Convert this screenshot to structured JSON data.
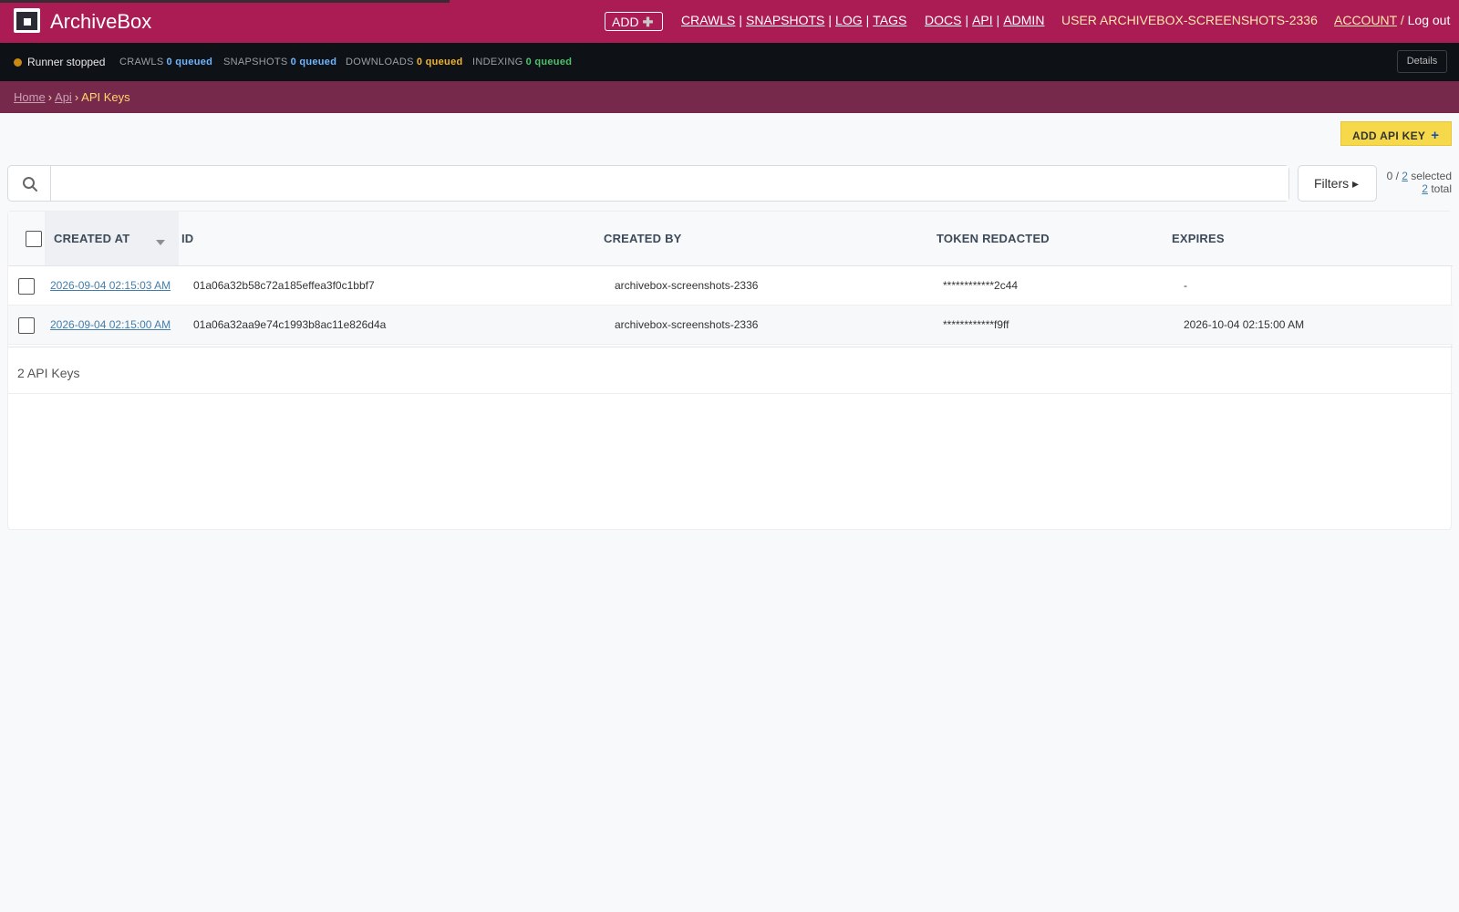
{
  "header": {
    "brand": "ArchiveBox",
    "add_label": "ADD",
    "add_icon": "plus-icon",
    "nav_crawls": "CRAWLS",
    "nav_snapshots": "SNAPSHOTS",
    "nav_log": "LOG",
    "nav_tags": "TAGS",
    "nav_docs": "DOCS",
    "nav_api": "API",
    "nav_admin": "ADMIN",
    "separator": "|",
    "user_label": "USER ARCHIVEBOX-SCREENSHOTS-2336",
    "account_label": "ACCOUNT",
    "account_sep": "/",
    "logout_label": "Log out"
  },
  "status": {
    "runner": "Runner stopped",
    "crawls_label": "CRAWLS",
    "crawls_value": "0 queued",
    "snapshots_label": "SNAPSHOTS",
    "snapshots_value": "0 queued",
    "downloads_label": "DOWNLOADS",
    "downloads_value": "0 queued",
    "indexing_label": "INDEXING",
    "indexing_value": "0 queued",
    "details_label": "Details",
    "colors": {
      "crawls": "#6fb6ff",
      "snapshots": "#6fb6ff",
      "downloads": "#f0b429",
      "indexing": "#4cc36a",
      "runner_dot": "#c88a12"
    }
  },
  "breadcrumbs": {
    "home": "Home",
    "api": "Api",
    "current": "API Keys",
    "arrow": "›"
  },
  "toolbar": {
    "add_key_label": "ADD API KEY",
    "add_key_icon": "+",
    "search_placeholder": "",
    "filters_label": "Filters ▸",
    "selected_prefix": "0 /",
    "selected_count": "2",
    "selected_suffix": "selected",
    "total_count": "2",
    "total_suffix": "total"
  },
  "table": {
    "columns": [
      "CREATED AT",
      "ID",
      "CREATED BY",
      "TOKEN REDACTED",
      "EXPIRES"
    ],
    "rows": [
      {
        "created_at": "2026-09-04 02:15:03 AM",
        "id": "01a06a32b58c72a185effea3f0c1bbf7",
        "created_by": "archivebox-screenshots-2336",
        "token": "************2c44",
        "expires": "-"
      },
      {
        "created_at": "2026-09-04 02:15:00 AM",
        "id": "01a06a32aa9e74c1993b8ac11e826d4a",
        "created_by": "archivebox-screenshots-2336",
        "token": "************f9ff",
        "expires": "2026-10-04 02:15:00 AM"
      }
    ],
    "footer": "2 API Keys"
  },
  "colors": {
    "header_bg": "#ab1c55",
    "statusbar_bg": "#0e1116",
    "breadcrumb_bg": "#76294a",
    "accent_yellow": "#f6d94b",
    "link": "#447eaa"
  }
}
